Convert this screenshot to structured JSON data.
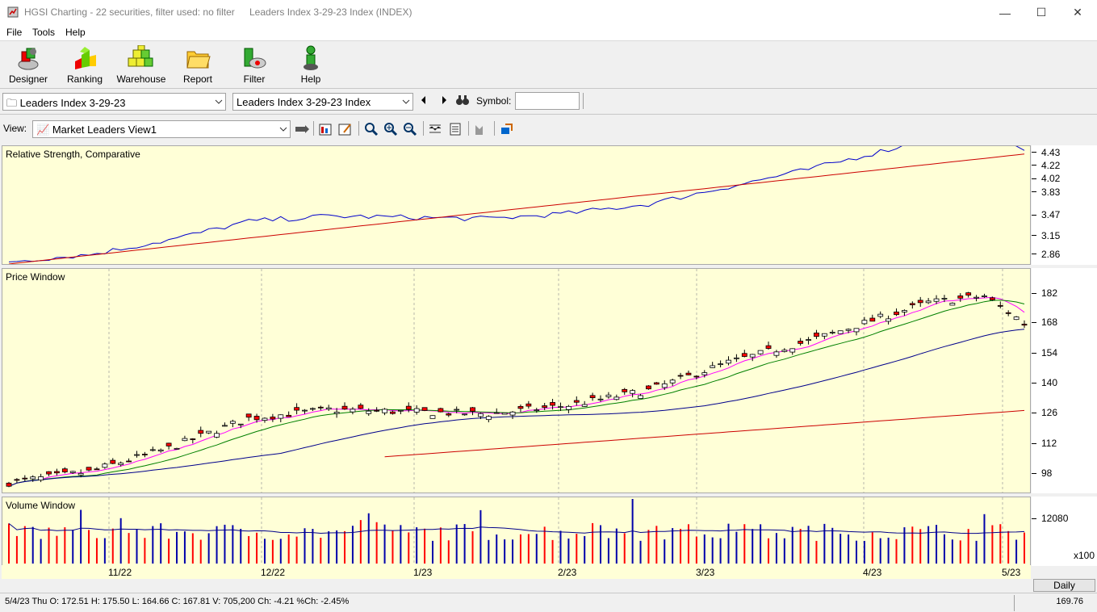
{
  "window": {
    "app_title": "HGSI Charting - 22 securities, filter used: no filter",
    "doc_title": "Leaders Index 3-29-23 Index (INDEX)",
    "minimize_icon": "minimize-icon",
    "maximize_icon": "maximize-icon",
    "close_icon": "close-icon"
  },
  "menu": {
    "items": [
      "File",
      "Tools",
      "Help"
    ]
  },
  "toolbar": {
    "buttons": [
      {
        "label": "Designer",
        "icon": "designer-icon"
      },
      {
        "label": "Ranking",
        "icon": "ranking-icon"
      },
      {
        "label": "Warehouse",
        "icon": "warehouse-icon"
      },
      {
        "label": "Report",
        "icon": "report-icon"
      },
      {
        "label": "Filter",
        "icon": "filter-icon"
      },
      {
        "label": "Help",
        "icon": "help-icon"
      }
    ]
  },
  "selector": {
    "list_value": "Leaders Index 3-29-23",
    "security_value": "Leaders Index 3-29-23 Index",
    "symbol_label": "Symbol:",
    "symbol_value": ""
  },
  "view": {
    "label": "View:",
    "value": "Market Leaders View1"
  },
  "panels": {
    "rs": {
      "title": "Relative Strength, Comparative",
      "ticks": [
        "4.43",
        "4.22",
        "4.02",
        "3.83",
        "3.47",
        "3.15",
        "2.86"
      ]
    },
    "price": {
      "title": "Price Window",
      "ticks": [
        "182",
        "168",
        "154",
        "140",
        "126",
        "112",
        "98"
      ]
    },
    "volume": {
      "title": "Volume Window",
      "ticks": [
        "12080"
      ],
      "multiplier": "x100"
    }
  },
  "date_axis": {
    "labels": [
      "11/22",
      "12/22",
      "1/23",
      "2/23",
      "3/23",
      "4/23",
      "5/23"
    ]
  },
  "status": {
    "bar_info": "5/4/23 Thu O: 172.51 H: 175.50 L: 164.66 C: 167.81 V: 705,200 Ch: -4.21 %Ch: -2.45%",
    "cursor_value": "169.76",
    "period_button": "Daily"
  },
  "colors": {
    "panel_bg": "#ffffd7",
    "up_candle": "#ffffff",
    "down_candle": "#ff0000",
    "ma_short": "#ff00ff",
    "ma_mid": "#008000",
    "ma_long": "#00008b",
    "ma_200": "#cc0000",
    "rs_line": "#0000cc"
  },
  "chart_data": {
    "type": "candlestick",
    "first_close": 94,
    "last_close": 167.81,
    "last_bar": {
      "date": "5/4/23",
      "open": 172.51,
      "high": 175.5,
      "low": 164.66,
      "close": 167.81,
      "volume": 705200
    }
  }
}
